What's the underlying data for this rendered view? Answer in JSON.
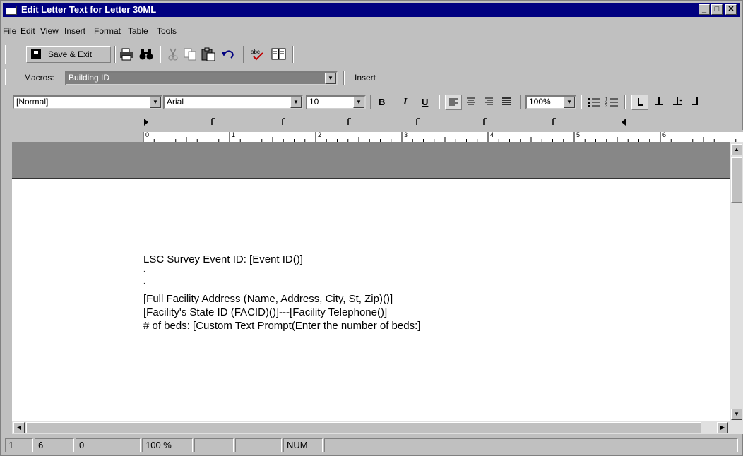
{
  "window": {
    "title": "Edit Letter Text for Letter 30ML"
  },
  "menu": [
    "File",
    "Edit",
    "View",
    "Insert",
    "Format",
    "Table",
    "Tools"
  ],
  "toolbar": {
    "save_exit_label": "Save & Exit",
    "icons": [
      "print-icon",
      "find-icon",
      "cut-icon",
      "copy-icon",
      "paste-icon",
      "undo-icon",
      "spellcheck-icon",
      "thesaurus-icon"
    ]
  },
  "macros": {
    "label": "Macros:",
    "selected": "Building ID",
    "insert_label": "Insert"
  },
  "format": {
    "style": "[Normal]",
    "font": "Arial",
    "size": "10",
    "bold": "B",
    "italic": "I",
    "underline": "U",
    "zoom": "100%"
  },
  "ruler": {
    "numbers": [
      "0",
      "1",
      "2",
      "3",
      "4",
      "5",
      "6"
    ]
  },
  "document": {
    "lines": [
      "LSC Survey Event ID:   [Event ID()]",
      ".",
      ".",
      "[Full Facility Address (Name, Address, City, St, Zip)()]",
      "[Facility's State ID (FACID)()]---[Facility Telephone()]",
      "# of beds: [Custom Text Prompt(Enter the number of beds:]"
    ]
  },
  "status": {
    "line": "1",
    "col": "6",
    "pos": "0",
    "zoom": "100 %",
    "num": "NUM"
  },
  "colors": {
    "titlebar": "#000080",
    "face": "#c0c0c0",
    "band": "#878787"
  }
}
